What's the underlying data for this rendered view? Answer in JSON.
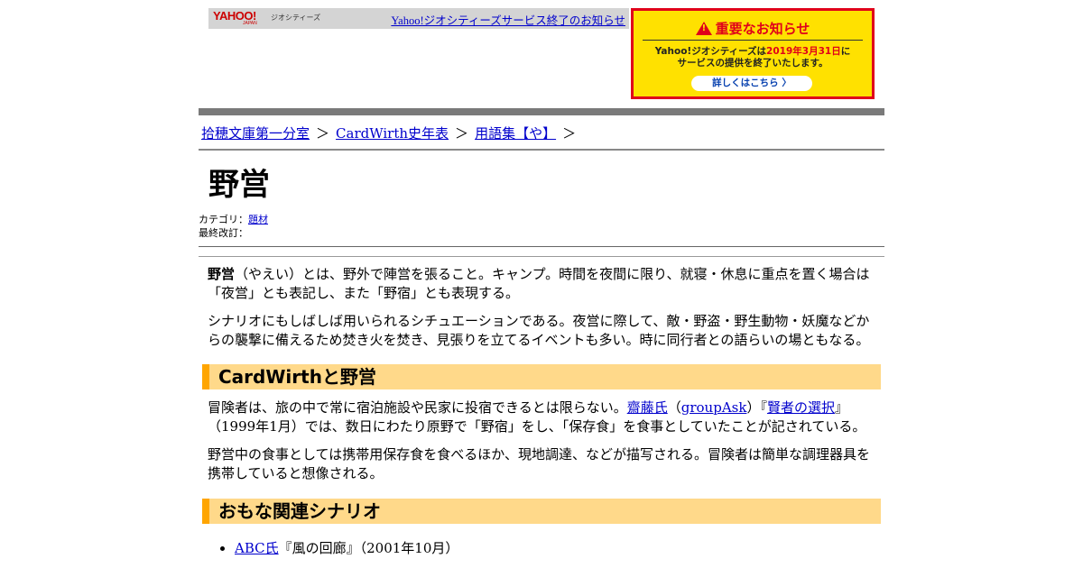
{
  "banner": {
    "logo_text": "YAHOO!",
    "logo_sub": "JAPAN",
    "geo_text": "ジオシティーズ",
    "notice_link": "Yahoo!ジオシティーズサービス終了のお知らせ",
    "notice_box": {
      "title": "重要なお知らせ",
      "line1_a": "Yahoo!ジオシティーズは",
      "line1_red": "2019年3月31日",
      "line1_b": "に",
      "line2": "サービスの提供を終了いたします。",
      "button": "詳しくはこちら 〉"
    }
  },
  "breadcrumb": {
    "items": [
      "拾穂文庫第一分室",
      "CardWirth史年表",
      "用語集【や】"
    ],
    "separator": "＞"
  },
  "page_title": "野営",
  "meta": {
    "category_label": "カテゴリ：",
    "category_value": "題材",
    "revised_label": "最終改訂："
  },
  "content": {
    "p1_term": "野営",
    "p1_rest": "（やえい）とは、野外で陣営を張ること。キャンプ。時間を夜間に限り、就寝・休息に重点を置く場合は「夜営」とも表記し、また「野宿」とも表現する。",
    "p2": "シナリオにもしばしば用いられるシチュエーションである。夜営に際して、敵・野盗・野生動物・妖魔などからの襲撃に備えるため焚き火を焚き、見張りを立てるイベントも多い。時に同行者との語らいの場ともなる。",
    "section1": "CardWirthと野営",
    "p3_a": "冒険者は、旅の中で常に宿泊施設や民家に投宿できるとは限らない。",
    "p3_link1": "齋藤氏",
    "p3_b": "（",
    "p3_link2": "groupAsk",
    "p3_c": "）『",
    "p3_link3": "賢者の選択",
    "p3_d": "』（1999年1月）では、数日にわたり原野で「野宿」をし、「保存食」を食事としていたことが記されている。",
    "p4": "野営中の食事としては携帯用保存食を食べるほか、現地調達、などが描写される。冒険者は簡単な調理器具を携帯していると想像される。",
    "section2": "おもな関連シナリオ",
    "scenarios": [
      {
        "author": "ABC氏",
        "rest": "『風の回廊』（2001年10月）"
      }
    ]
  },
  "colors": {
    "accent_orange": "#ffa500",
    "section_bg": "#ffd98a",
    "notice_yellow": "#ffe100",
    "notice_red": "#e0001a",
    "link": "#0000cc"
  }
}
